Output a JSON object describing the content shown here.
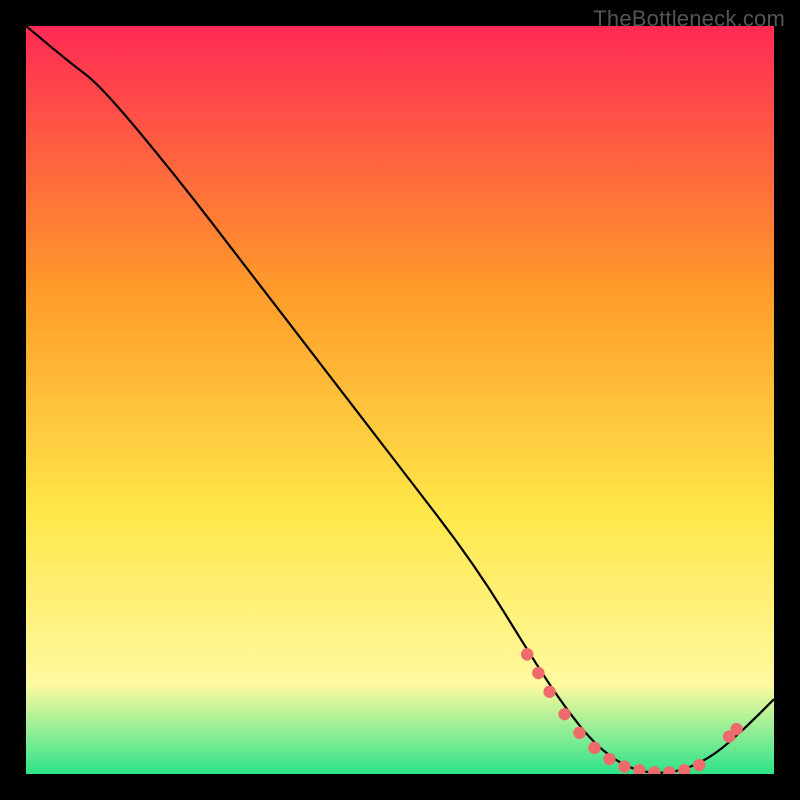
{
  "watermark": "TheBottleneck.com",
  "colors": {
    "background": "#000000",
    "curve": "#000000",
    "marker_fill": "#ef6b6b",
    "marker_stroke": "#c94a4a",
    "gradient_top": "#ff2a55",
    "gradient_mid1": "#ff9a2a",
    "gradient_mid2": "#ffe74a",
    "gradient_low": "#fff9a0",
    "gradient_bottom": "#2de38a"
  },
  "chart_data": {
    "type": "line",
    "title": "",
    "xlabel": "",
    "ylabel": "",
    "xlim": [
      0,
      100
    ],
    "ylim": [
      0,
      100
    ],
    "curve": {
      "x": [
        0,
        6,
        10,
        20,
        30,
        40,
        50,
        60,
        68,
        72,
        76,
        80,
        84,
        88,
        92,
        96,
        100
      ],
      "y": [
        100,
        95,
        92,
        80,
        67,
        54,
        41,
        28,
        15,
        9,
        4,
        1,
        0,
        0.5,
        2.5,
        6,
        10
      ]
    },
    "series": [
      {
        "name": "markers",
        "x": [
          67,
          68.5,
          70,
          72,
          74,
          76,
          78,
          80,
          82,
          84,
          86,
          88,
          90,
          94,
          95
        ],
        "y": [
          16,
          13.5,
          11,
          8,
          5.5,
          3.5,
          2,
          1,
          0.5,
          0.2,
          0.2,
          0.5,
          1.2,
          5,
          6
        ]
      }
    ]
  }
}
